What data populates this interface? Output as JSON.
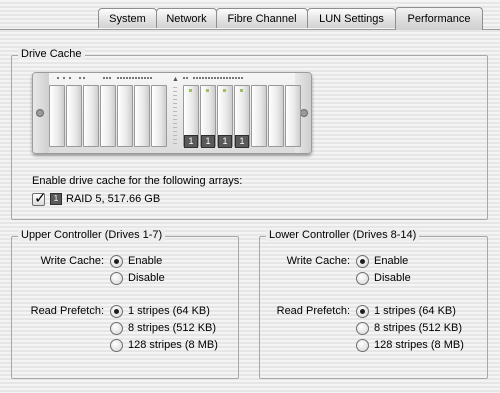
{
  "tabs": [
    {
      "label": "System"
    },
    {
      "label": "Network"
    },
    {
      "label": "Fibre Channel"
    },
    {
      "label": "LUN Settings"
    },
    {
      "label": "Performance"
    }
  ],
  "drive_cache": {
    "title": "Drive Cache",
    "enclosure_tags": [
      "1",
      "1",
      "1",
      "1"
    ],
    "instruction": "Enable drive cache for the following arrays:",
    "array_badge": "1",
    "array_label": "RAID 5, 517.66 GB",
    "array_checked": true
  },
  "upper": {
    "title": "Upper Controller (Drives 1-7)",
    "write_cache_label": "Write Cache:",
    "write_options": [
      {
        "label": "Enable",
        "selected": true
      },
      {
        "label": "Disable",
        "selected": false
      }
    ],
    "read_prefetch_label": "Read Prefetch:",
    "prefetch_options": [
      {
        "label": "1 stripes (64 KB)",
        "selected": true
      },
      {
        "label": "8 stripes (512 KB)",
        "selected": false
      },
      {
        "label": "128 stripes (8 MB)",
        "selected": false
      }
    ]
  },
  "lower": {
    "title": "Lower Controller (Drives 8-14)",
    "write_cache_label": "Write Cache:",
    "write_options": [
      {
        "label": "Enable",
        "selected": true
      },
      {
        "label": "Disable",
        "selected": false
      }
    ],
    "read_prefetch_label": "Read Prefetch:",
    "prefetch_options": [
      {
        "label": "1 stripes (64 KB)",
        "selected": true
      },
      {
        "label": "8 stripes (512 KB)",
        "selected": false
      },
      {
        "label": "128 stripes (8 MB)",
        "selected": false
      }
    ]
  }
}
